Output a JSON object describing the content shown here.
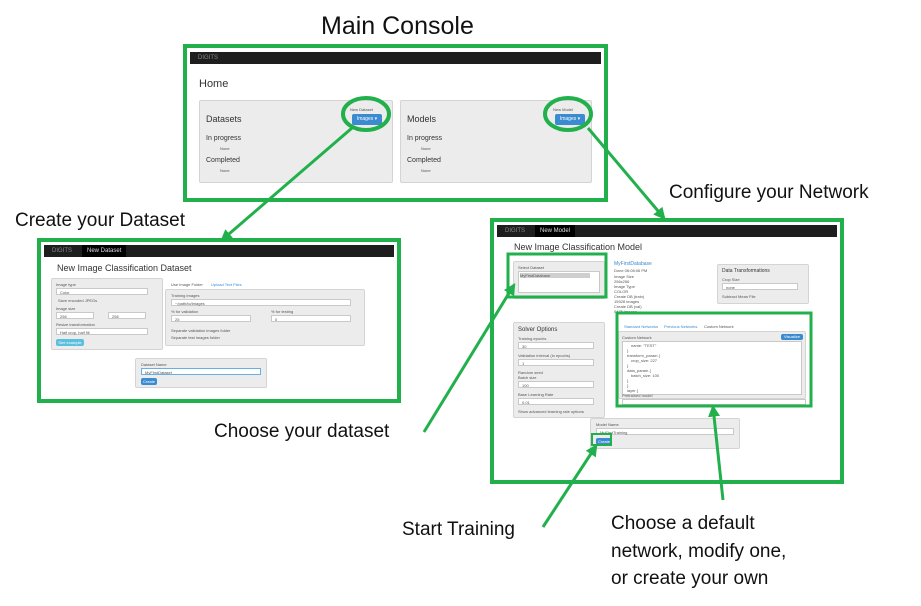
{
  "captions": {
    "main_console": "Main Console",
    "create_dataset": "Create your Dataset",
    "configure_network": "Configure your Network",
    "choose_dataset": "Choose your dataset",
    "start_training": "Start Training",
    "choose_default_1": "Choose a default",
    "choose_default_2": "network, modify one,",
    "choose_default_3": "or create your own"
  },
  "colors": {
    "highlight": "#21b04b",
    "primary_button": "#3b8bd0",
    "navbar": "#1e1e1e"
  },
  "main_console": {
    "brand": "DIGITS",
    "page_title": "Home",
    "datasets": {
      "title": "Datasets",
      "new_label": "New Dataset",
      "button": "Images ▾",
      "in_progress": "In progress",
      "in_progress_item": "None",
      "completed": "Completed",
      "completed_item": "None"
    },
    "models": {
      "title": "Models",
      "new_label": "New Model",
      "button": "Images ▾",
      "in_progress": "In progress",
      "in_progress_item": "None",
      "completed": "Completed",
      "completed_item": "None"
    }
  },
  "dataset_screen": {
    "brand": "DIGITS",
    "nav_item": "New Dataset",
    "title": "New Image Classification Dataset",
    "image_type_label": "Image type",
    "image_type_value": "Color",
    "save_encoded": "Save encoded JPEGs",
    "image_size_label": "Image size",
    "width": "256",
    "height": "256",
    "resize_label": "Resize transformation",
    "resize_value": "Half crop, half fill",
    "see_example": "See example",
    "tab_folder": "Use Image Folder",
    "tab_textfiles": "Upload Text Files",
    "training_images_label": "Training Images",
    "training_images_value": "~/path/to/images",
    "pct_validation_label": "% for validation",
    "pct_validation_value": "25",
    "pct_testing_label": "% for testing",
    "pct_testing_value": "0",
    "sep_validation": "Separate validation images folder",
    "sep_test": "Separate test images folder",
    "dataset_name_label": "Dataset Name",
    "dataset_name_value": "MyFirstDataset",
    "create_button": "Create"
  },
  "model_screen": {
    "brand": "DIGITS",
    "nav_item": "New Model",
    "title": "New Image Classification Model",
    "select_dataset_label": "Select Dataset",
    "select_dataset_value": "MyFirstDatabase",
    "dataset_info": {
      "name": "MyFirstDatabase",
      "done": "Done 06:08:06 PM",
      "lines": [
        "Image Size",
        "256x256",
        "Image Type",
        "COLOR",
        "Create DB (train)",
        "15928 images",
        "Create DB (val)",
        "5475 images"
      ]
    },
    "data_transformations": "Data Transformations",
    "crop_size_label": "Crop Size",
    "crop_size_value": "none",
    "subtract_mean": "Subtract Mean File",
    "solver_options": "Solver Options",
    "training_epochs_label": "Training epochs",
    "training_epochs_value": "30",
    "validation_interval_label": "Validation interval (in epochs)",
    "validation_interval_value": "1",
    "random_seed_label": "Random seed",
    "batch_size_label": "Batch size",
    "batch_size_value": "100",
    "base_lr_label": "Base Learning Rate",
    "base_lr_value": "0.01",
    "advanced_options": "Show advanced learning rate options",
    "tabs": [
      "Standard Networks",
      "Previous Networks",
      "Custom Network"
    ],
    "custom_network_label": "Custom Network",
    "visualize_button": "Visualize",
    "code_lines": [
      "name: \"TEST\"",
      "}",
      "transform_param {",
      "  crop_size: 227",
      "}",
      "data_param {",
      "  batch_size: 100",
      "}",
      "}",
      "layer {",
      "  name: \"conv1\""
    ],
    "pretrained_label": "Pretrained model",
    "model_name_label": "Model Name",
    "model_name_value": "MyFirstTraining",
    "create_button": "Create"
  }
}
